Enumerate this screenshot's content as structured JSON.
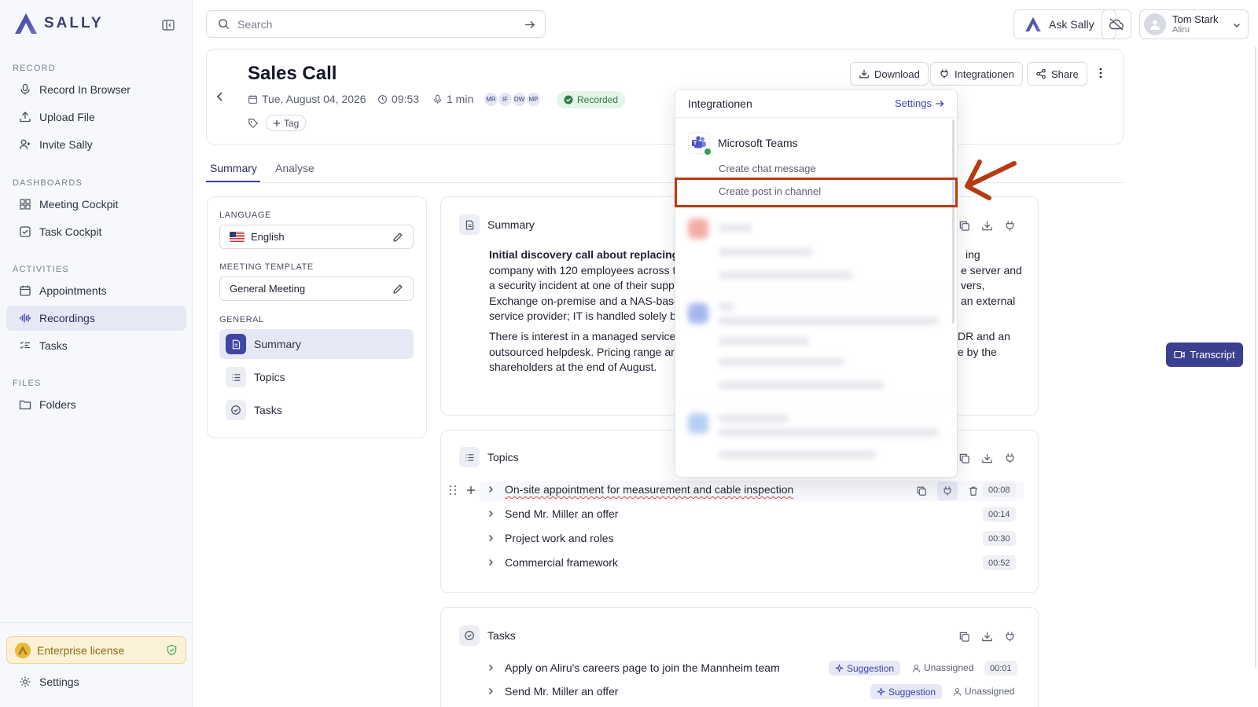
{
  "app": {
    "name": "SALLY"
  },
  "sidebar": {
    "sections": [
      {
        "label": "RECORD",
        "items": [
          {
            "label": "Record In Browser",
            "icon": "mic-icon"
          },
          {
            "label": "Upload File",
            "icon": "upload-icon"
          },
          {
            "label": "Invite Sally",
            "icon": "user-plus-icon"
          }
        ]
      },
      {
        "label": "DASHBOARDS",
        "items": [
          {
            "label": "Meeting Cockpit",
            "icon": "grid-icon"
          },
          {
            "label": "Task Cockpit",
            "icon": "checkbox-icon"
          }
        ]
      },
      {
        "label": "ACTIVITIES",
        "items": [
          {
            "label": "Appointments",
            "icon": "calendar-icon"
          },
          {
            "label": "Recordings",
            "icon": "waveform-icon",
            "active": true
          },
          {
            "label": "Tasks",
            "icon": "task-list-icon"
          }
        ]
      },
      {
        "label": "FILES",
        "items": [
          {
            "label": "Folders",
            "icon": "folder-icon"
          }
        ]
      }
    ],
    "license_label": "Enterprise license",
    "settings_label": "Settings"
  },
  "topbar": {
    "search_placeholder": "Search",
    "ask_label": "Ask Sally",
    "user": {
      "name": "Tom Stark",
      "org": "Aliru"
    }
  },
  "meeting": {
    "title": "Sales Call",
    "date": "Tue, August 04, 2026",
    "time": "09:53",
    "duration": "1 min",
    "participants": [
      "MR",
      "IF",
      "DW",
      "MP"
    ],
    "status": "Recorded",
    "tag_label": "Tag",
    "actions": {
      "download": "Download",
      "integrations": "Integrationen",
      "share": "Share"
    }
  },
  "tabs": [
    {
      "label": "Summary",
      "active": true
    },
    {
      "label": "Analyse"
    }
  ],
  "settings_panel": {
    "language_label": "LANGUAGE",
    "language_value": "English",
    "template_label": "MEETING TEMPLATE",
    "template_value": "General Meeting",
    "general_label": "GENERAL",
    "general_items": [
      "Summary",
      "Topics",
      "Tasks"
    ]
  },
  "summary": {
    "title": "Summary",
    "p1_bold": "Initial discovery call about replacing t",
    "p1_rest": "…ing",
    "lines1": [
      "company with 120 employees across t",
      "a security incident at one of their supp",
      "Exchange on-premise and a NAS-base",
      "service provider; IT is handled solely by"
    ],
    "lines1_right": [
      "e server and",
      "vers,",
      "an external"
    ],
    "lines2": [
      "There is interest in a managed service",
      "outsourced helpdesk. Pricing range ar",
      "shareholders at the end of August."
    ],
    "lines2_right": [
      "DR and an",
      "e by the"
    ]
  },
  "topics": {
    "title": "Topics",
    "items": [
      {
        "label": "On-site appointment for measurement and cable inspection",
        "time": "00:08"
      },
      {
        "label": "Send Mr. Miller an offer",
        "time": "00:14"
      },
      {
        "label": "Project work and roles",
        "time": "00:30"
      },
      {
        "label": "Commercial framework",
        "time": "00:52"
      }
    ]
  },
  "tasks": {
    "title": "Tasks",
    "items": [
      {
        "label": "Apply on Aliru's careers page to join the Mannheim team",
        "badge": "Suggestion",
        "assignee": "Unassigned",
        "time": "00:01"
      },
      {
        "label": "Send Mr. Miller an offer",
        "badge": "Suggestion",
        "assignee": "Unassigned"
      }
    ]
  },
  "transcript_label": "Transcript",
  "integrations_dropdown": {
    "title": "Integrationen",
    "settings_label": "Settings",
    "app_name": "Microsoft Teams",
    "options": [
      "Create chat message",
      "Create post in channel"
    ]
  },
  "colors": {
    "accent": "#3f44a8",
    "highlight": "#b83a12",
    "status_green": "#2f7a46"
  }
}
